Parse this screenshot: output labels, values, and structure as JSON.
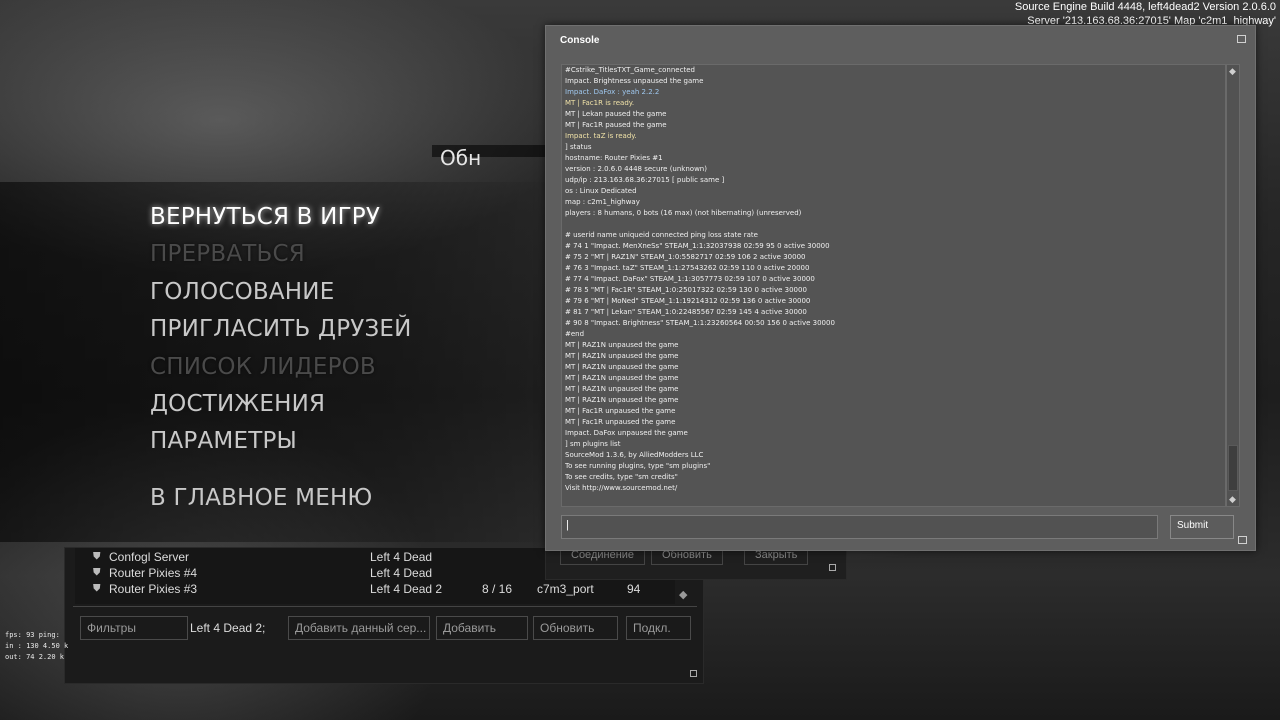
{
  "build_info": {
    "line1": "Source Engine Build 4448, left4dead2 Version 2.0.6.0",
    "line2": "Server '213.163.68.36:27015' Map 'c2m1_highway'"
  },
  "background": {
    "partial_text": "Обн"
  },
  "main_menu": {
    "items": [
      {
        "label": "ВЕРНУТЬСЯ В ИГРУ",
        "state": "active"
      },
      {
        "label": "ПРЕРВАТЬСЯ",
        "state": "disabled"
      },
      {
        "label": "ГОЛОСОВАНИЕ",
        "state": "normal"
      },
      {
        "label": "ПРИГЛАСИТЬ ДРУЗЕЙ",
        "state": "normal"
      },
      {
        "label": "СПИСОК ЛИДЕРОВ",
        "state": "disabled"
      },
      {
        "label": "ДОСТИЖЕНИЯ",
        "state": "normal"
      },
      {
        "label": "ПАРАМЕТРЫ",
        "state": "normal"
      },
      {
        "label": "В ГЛАВНОЕ МЕНЮ",
        "state": "normal"
      }
    ]
  },
  "console": {
    "title": "Console",
    "input_value": "",
    "submit_label": "Submit",
    "lines": [
      {
        "text": "#Cstrike_TitlesTXT_Game_connected",
        "color": "white"
      },
      {
        "text": "Impact. Brightness unpaused the game",
        "color": "white"
      },
      {
        "text": "Impact. DaFox :  yeah 2.2.2",
        "color": "blue"
      },
      {
        "text": "MT | Fac1R is ready.",
        "color": "yellow"
      },
      {
        "text": "MT | Lekan paused the game",
        "color": "white"
      },
      {
        "text": "MT | Fac1R paused the game",
        "color": "white"
      },
      {
        "text": "Impact. taZ is ready.",
        "color": "yellow"
      },
      {
        "text": "] status",
        "color": "white"
      },
      {
        "text": "hostname: Router Pixies #1",
        "color": "white"
      },
      {
        "text": "version : 2.0.6.0 4448 secure  (unknown)",
        "color": "white"
      },
      {
        "text": "udp/ip  : 213.163.68.36:27015 [ public same ]",
        "color": "white"
      },
      {
        "text": "os      : Linux Dedicated",
        "color": "white"
      },
      {
        "text": "map     : c2m1_highway",
        "color": "white"
      },
      {
        "text": "players : 8 humans, 0 bots (16 max) (not hibernating) (unreserved)",
        "color": "white"
      },
      {
        "text": "",
        "color": "white"
      },
      {
        "text": "# userid name uniqueid connected ping loss state rate",
        "color": "white"
      },
      {
        "text": "# 74 1 \"Impact. MenXneSs\" STEAM_1:1:32037938 02:59 95 0 active 30000",
        "color": "white"
      },
      {
        "text": "# 75 2 \"MT | RAZ1N\" STEAM_1:0:5582717 02:59 106 2 active 30000",
        "color": "white"
      },
      {
        "text": "# 76 3 \"Impact. taZ\" STEAM_1:1:27543262 02:59 110 0 active 20000",
        "color": "white"
      },
      {
        "text": "# 77 4 \"Impact. DaFox\" STEAM_1:1:3057773 02:59 107 0 active 30000",
        "color": "white"
      },
      {
        "text": "# 78 5 \"MT | Fac1R\" STEAM_1:0:25017322 02:59 130 0 active 30000",
        "color": "white"
      },
      {
        "text": "# 79 6 \"MT | MoNed\" STEAM_1:1:19214312 02:59 136 0 active 30000",
        "color": "white"
      },
      {
        "text": "# 81 7 \"MT | Lekan\" STEAM_1:0:22485567 02:59 145 4 active 30000",
        "color": "white"
      },
      {
        "text": "# 90 8 \"Impact. Brightness\" STEAM_1:1:23260564 00:50 156 0 active 30000",
        "color": "white"
      },
      {
        "text": "#end",
        "color": "white"
      },
      {
        "text": "MT | RAZ1N unpaused the game",
        "color": "white"
      },
      {
        "text": "MT | RAZ1N unpaused the game",
        "color": "white"
      },
      {
        "text": "MT | RAZ1N unpaused the game",
        "color": "white"
      },
      {
        "text": "MT | RAZ1N unpaused the game",
        "color": "white"
      },
      {
        "text": "MT | RAZ1N unpaused the game",
        "color": "white"
      },
      {
        "text": "MT | RAZ1N unpaused the game",
        "color": "white"
      },
      {
        "text": "MT | Fac1R unpaused the game",
        "color": "white"
      },
      {
        "text": "MT | Fac1R unpaused the game",
        "color": "white"
      },
      {
        "text": "Impact. DaFox unpaused the game",
        "color": "white"
      },
      {
        "text": "] sm plugins list",
        "color": "white"
      },
      {
        "text": "SourceMod 1.3.6, by AlliedModders LLC",
        "color": "white"
      },
      {
        "text": "To see running plugins, type \"sm plugins\"",
        "color": "white"
      },
      {
        "text": "To see credits, type \"sm credits\"",
        "color": "white"
      },
      {
        "text": "Visit http://www.sourcemod.net/",
        "color": "white"
      }
    ]
  },
  "behind_dialog": {
    "buttons": [
      "Соединение",
      "Обновить",
      "Закрыть"
    ]
  },
  "server_browser": {
    "rows": [
      {
        "name": "Confogl Server",
        "game": "Left 4 Dead",
        "players": "",
        "map": "",
        "ping": ""
      },
      {
        "name": "Router Pixies #4",
        "game": "Left 4 Dead",
        "players": "",
        "map": "",
        "ping": ""
      },
      {
        "name": "Router Pixies #3",
        "game": "Left 4 Dead 2",
        "players": "8 / 16",
        "map": "c7m3_port",
        "ping": "94"
      }
    ],
    "filters_label": "Фильтры",
    "filter_value": "Left 4 Dead 2;",
    "add_current_label": "Добавить данный сер...",
    "add_label": "Добавить",
    "refresh_label": "Обновить",
    "connect_label": "Подкл."
  },
  "netgraph": {
    "lines": [
      "fps:  93   ping:",
      "in :  130   4.50 k",
      "out:  74   2.20 k"
    ]
  }
}
